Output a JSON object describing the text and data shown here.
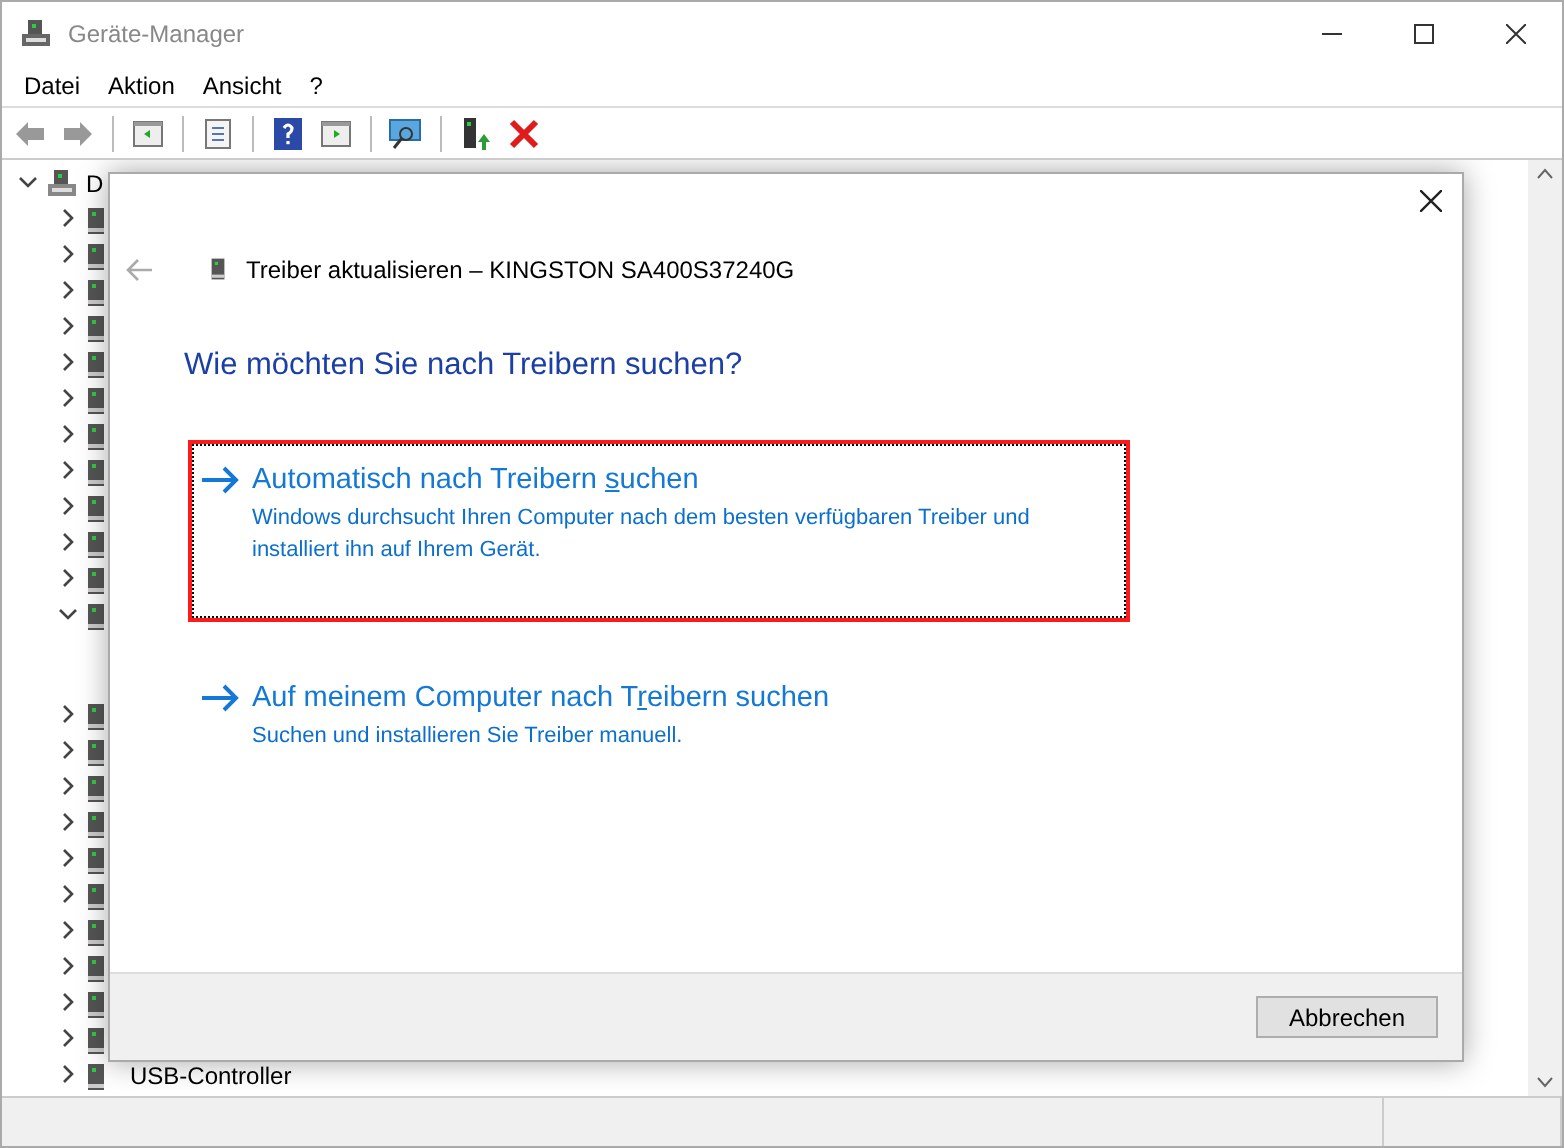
{
  "window": {
    "title": "Geräte-Manager"
  },
  "menu": [
    "Datei",
    "Aktion",
    "Ansicht",
    "?"
  ],
  "tree": {
    "root": {
      "label": "D",
      "expanded": true
    },
    "items": [
      {
        "expanded": false
      },
      {
        "expanded": false
      },
      {
        "expanded": false
      },
      {
        "expanded": false
      },
      {
        "expanded": false
      },
      {
        "expanded": false
      },
      {
        "expanded": false
      },
      {
        "expanded": false
      },
      {
        "expanded": false
      },
      {
        "expanded": false
      },
      {
        "expanded": false
      },
      {
        "expanded": true
      },
      {
        "expanded": false
      },
      {
        "expanded": false
      },
      {
        "expanded": false
      },
      {
        "expanded": false
      },
      {
        "expanded": false
      },
      {
        "expanded": false
      },
      {
        "expanded": false
      },
      {
        "expanded": false
      },
      {
        "expanded": false
      },
      {
        "expanded": false
      },
      {
        "expanded": false,
        "label": "USB-Controller"
      }
    ]
  },
  "dialog": {
    "title": "Treiber aktualisieren – KINGSTON SA400S37240G",
    "heading": "Wie möchten Sie nach Treibern suchen?",
    "options": [
      {
        "title_before": "Automatisch nach Treibern ",
        "access_key": "s",
        "title_after": "uchen",
        "description": "Windows durchsucht Ihren Computer nach dem besten verfügbaren Treiber und installiert ihn auf Ihrem Gerät.",
        "selected": true
      },
      {
        "title_before": "Auf meinem Computer nach T",
        "access_key": "r",
        "title_after": "eibern suchen",
        "description": "Suchen und installieren Sie Treiber manuell.",
        "selected": false
      }
    ],
    "cancel": "Abbrechen"
  }
}
